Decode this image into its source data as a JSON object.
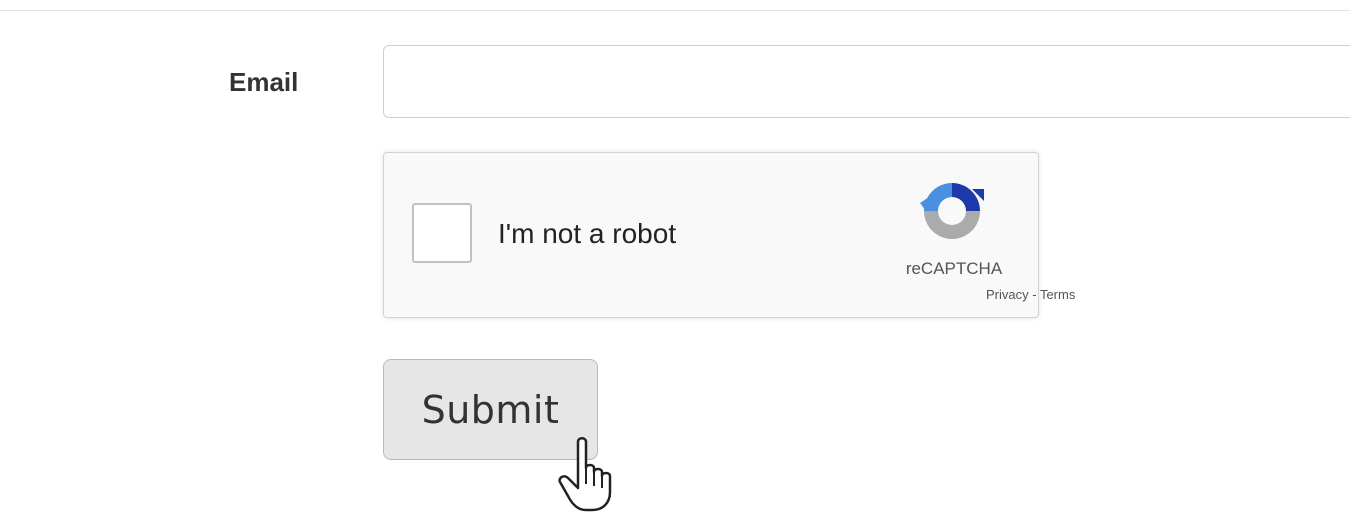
{
  "form": {
    "email_label": "Email",
    "email_value": "",
    "email_placeholder": ""
  },
  "recaptcha": {
    "label": "I'm not a robot",
    "brand": "reCAPTCHA",
    "privacy_link": "Privacy",
    "separator": " - ",
    "terms_link": "Terms",
    "checked": false
  },
  "submit": {
    "label": "Submit"
  },
  "colors": {
    "recaptcha_blue_dark": "#1c3aa9",
    "recaptcha_blue_light": "#4a90e2",
    "recaptcha_gray": "#ababab"
  },
  "icons": {
    "recaptcha_logo": "recaptcha-logo-icon",
    "cursor": "hand-pointer-cursor-icon"
  }
}
